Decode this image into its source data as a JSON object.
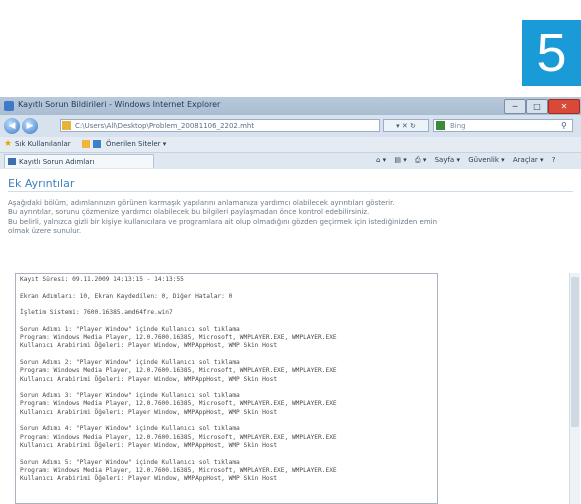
{
  "step_number": "5",
  "browser": {
    "title": "Kayıtlı Sorun Bildirileri - Windows Internet Explorer",
    "address": "C:\\Users\\All\\Desktop\\Problem_20081106_2202.mht",
    "go_controls": "▾ ✕ ↻",
    "search_placeholder": "Bing",
    "window_buttons": {
      "min": "─",
      "max": "□",
      "close": "✕"
    },
    "nav": {
      "back": "◀",
      "forward": "▶"
    },
    "favorites_label": "Sık Kullanılanlar",
    "favorites_link": "Önerilen Siteler ▾",
    "tab_label": "Kayıtlı Sorun Adımları",
    "command_bar": [
      "Sayfa ▾",
      "Güvenlik ▾",
      "Araçlar ▾"
    ]
  },
  "page": {
    "title": "Ek Ayrıntılar",
    "description": [
      "Aşağıdaki bölüm, adımlarınızın görünen karmaşık yapılarını anlamanıza yardımcı olabilecek ayrıntıları gösterir.",
      "Bu ayrıntılar, sorunu çözmenize yardımcı olabilecek bu bilgileri paylaşmadan önce kontrol edebilirsiniz.",
      "Bu belirli, yalnızca gizli bir kişiye kullanıcılara ve programlara ait olup olmadığını gözden geçirmek için istediğinizden emin olmak üzere sunulur."
    ],
    "log_lines": [
      "Kayıt Süresi: 09.11.2009 14:13:15 - 14:13:55",
      "",
      "Ekran Adımları: 10, Ekran Kaydedilen: 0, Diğer Hatalar: 0",
      "",
      "İşletim Sistemi: 7600.16385.amd64fre.win7",
      "",
      "Sorun Adımı 1: \"Player Window\" içinde Kullanıcı sol tıklama",
      "Program: Windows Media Player, 12.0.7600.16385, Microsoft, WMPLAYER.EXE, WMPLAYER.EXE",
      "Kullanıcı Arabirimi Öğeleri: Player Window, WMPAppHost, WMP Skin Host",
      "",
      "Sorun Adımı 2: \"Player Window\" içinde Kullanıcı sol tıklama",
      "Program: Windows Media Player, 12.0.7600.16385, Microsoft, WMPLAYER.EXE, WMPLAYER.EXE",
      "Kullanıcı Arabirimi Öğeleri: Player Window, WMPAppHost, WMP Skin Host",
      "",
      "Sorun Adımı 3: \"Player Window\" içinde Kullanıcı sol tıklama",
      "Program: Windows Media Player, 12.0.7600.16385, Microsoft, WMPLAYER.EXE, WMPLAYER.EXE",
      "Kullanıcı Arabirimi Öğeleri: Player Window, WMPAppHost, WMP Skin Host",
      "",
      "Sorun Adımı 4: \"Player Window\" içinde Kullanıcı sol tıklama",
      "Program: Windows Media Player, 12.0.7600.16385, Microsoft, WMPLAYER.EXE, WMPLAYER.EXE",
      "Kullanıcı Arabirimi Öğeleri: Player Window, WMPAppHost, WMP Skin Host",
      "",
      "Sorun Adımı 5: \"Player Window\" içinde Kullanıcı sol tıklama",
      "Program: Windows Media Player, 12.0.7600.16385, Microsoft, WMPLAYER.EXE, WMPLAYER.EXE",
      "Kullanıcı Arabirimi Öğeleri: Player Window, WMPAppHost, WMP Skin Host"
    ]
  }
}
